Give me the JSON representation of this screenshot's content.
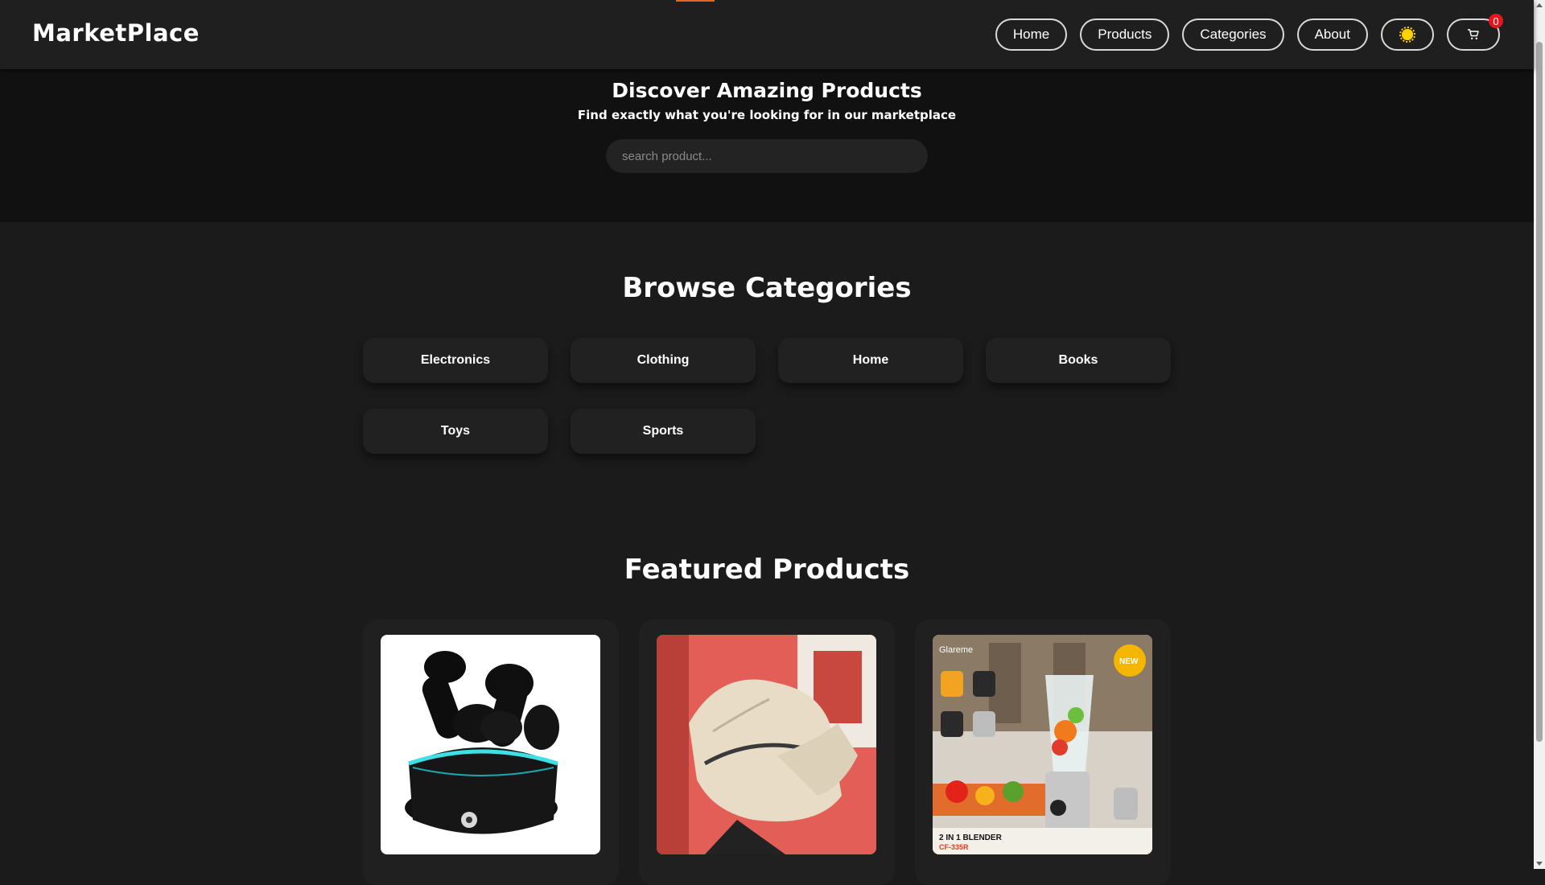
{
  "brand": {
    "name": "MarketPlace"
  },
  "nav": {
    "items": [
      {
        "label": "Home"
      },
      {
        "label": "Products"
      },
      {
        "label": "Categories"
      },
      {
        "label": "About"
      }
    ],
    "theme_icon": "sun-icon",
    "cart_icon": "cart-icon",
    "cart_count": "0"
  },
  "hero": {
    "title": "Discover Amazing Products",
    "subtitle": "Find exactly what you're looking for in our marketplace",
    "search_placeholder": "search product..."
  },
  "categories": {
    "title": "Browse Categories",
    "items": [
      {
        "label": "Electronics"
      },
      {
        "label": "Clothing"
      },
      {
        "label": "Home"
      },
      {
        "label": "Books"
      },
      {
        "label": "Toys"
      },
      {
        "label": "Sports"
      }
    ]
  },
  "featured": {
    "title": "Featured Products",
    "products": [
      {
        "image": "wireless-earbuds-photo"
      },
      {
        "image": "beige-sneaker-photo"
      },
      {
        "image": "blender-photo",
        "image_text": {
          "brand": "Glareme",
          "badge": "NEW",
          "caption": "2 IN 1 BLENDER",
          "model": "CF-335R"
        }
      }
    ]
  },
  "colors": {
    "page_bg": "#1b1b1b",
    "hero_bg": "#111111",
    "badge_red": "#e8141e",
    "accent_orange": "#e0662a"
  }
}
